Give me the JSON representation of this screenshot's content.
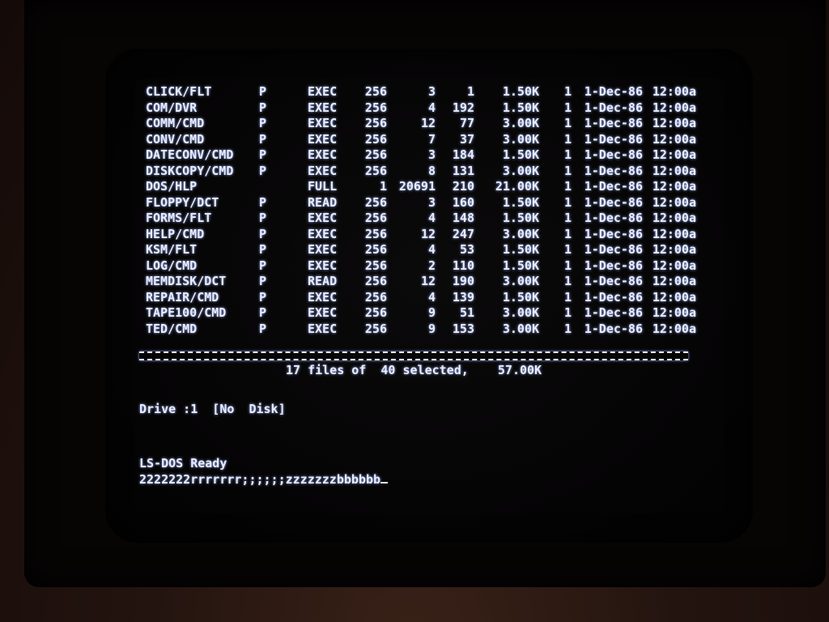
{
  "directory": {
    "rows": [
      {
        "name": "CLICK/FLT",
        "attr": "P",
        "access": "EXEC",
        "lrl": "256",
        "recs": "3",
        "eof": "1",
        "size": "1.50K",
        "ext": "1",
        "date": "1-Dec-86",
        "time": "12:00a"
      },
      {
        "name": "COM/DVR",
        "attr": "P",
        "access": "EXEC",
        "lrl": "256",
        "recs": "4",
        "eof": "192",
        "size": "1.50K",
        "ext": "1",
        "date": "1-Dec-86",
        "time": "12:00a"
      },
      {
        "name": "COMM/CMD",
        "attr": "P",
        "access": "EXEC",
        "lrl": "256",
        "recs": "12",
        "eof": "77",
        "size": "3.00K",
        "ext": "1",
        "date": "1-Dec-86",
        "time": "12:00a"
      },
      {
        "name": "CONV/CMD",
        "attr": "P",
        "access": "EXEC",
        "lrl": "256",
        "recs": "7",
        "eof": "37",
        "size": "3.00K",
        "ext": "1",
        "date": "1-Dec-86",
        "time": "12:00a"
      },
      {
        "name": "DATECONV/CMD",
        "attr": "P",
        "access": "EXEC",
        "lrl": "256",
        "recs": "3",
        "eof": "184",
        "size": "1.50K",
        "ext": "1",
        "date": "1-Dec-86",
        "time": "12:00a"
      },
      {
        "name": "DISKCOPY/CMD",
        "attr": "P",
        "access": "EXEC",
        "lrl": "256",
        "recs": "8",
        "eof": "131",
        "size": "3.00K",
        "ext": "1",
        "date": "1-Dec-86",
        "time": "12:00a"
      },
      {
        "name": "DOS/HLP",
        "attr": "",
        "access": "FULL",
        "lrl": "1",
        "recs": "20691",
        "eof": "210",
        "size": "21.00K",
        "ext": "1",
        "date": "1-Dec-86",
        "time": "12:00a"
      },
      {
        "name": "FLOPPY/DCT",
        "attr": "P",
        "access": "READ",
        "lrl": "256",
        "recs": "3",
        "eof": "160",
        "size": "1.50K",
        "ext": "1",
        "date": "1-Dec-86",
        "time": "12:00a"
      },
      {
        "name": "FORMS/FLT",
        "attr": "P",
        "access": "EXEC",
        "lrl": "256",
        "recs": "4",
        "eof": "148",
        "size": "1.50K",
        "ext": "1",
        "date": "1-Dec-86",
        "time": "12:00a"
      },
      {
        "name": "HELP/CMD",
        "attr": "P",
        "access": "EXEC",
        "lrl": "256",
        "recs": "12",
        "eof": "247",
        "size": "3.00K",
        "ext": "1",
        "date": "1-Dec-86",
        "time": "12:00a"
      },
      {
        "name": "KSM/FLT",
        "attr": "P",
        "access": "EXEC",
        "lrl": "256",
        "recs": "4",
        "eof": "53",
        "size": "1.50K",
        "ext": "1",
        "date": "1-Dec-86",
        "time": "12:00a"
      },
      {
        "name": "LOG/CMD",
        "attr": "P",
        "access": "EXEC",
        "lrl": "256",
        "recs": "2",
        "eof": "110",
        "size": "1.50K",
        "ext": "1",
        "date": "1-Dec-86",
        "time": "12:00a"
      },
      {
        "name": "MEMDISK/DCT",
        "attr": "P",
        "access": "READ",
        "lrl": "256",
        "recs": "12",
        "eof": "190",
        "size": "3.00K",
        "ext": "1",
        "date": "1-Dec-86",
        "time": "12:00a"
      },
      {
        "name": "REPAIR/CMD",
        "attr": "P",
        "access": "EXEC",
        "lrl": "256",
        "recs": "4",
        "eof": "139",
        "size": "1.50K",
        "ext": "1",
        "date": "1-Dec-86",
        "time": "12:00a"
      },
      {
        "name": "TAPE100/CMD",
        "attr": "P",
        "access": "EXEC",
        "lrl": "256",
        "recs": "9",
        "eof": "51",
        "size": "3.00K",
        "ext": "1",
        "date": "1-Dec-86",
        "time": "12:00a"
      },
      {
        "name": "TED/CMD",
        "attr": "P",
        "access": "EXEC",
        "lrl": "256",
        "recs": "9",
        "eof": "153",
        "size": "3.00K",
        "ext": "1",
        "date": "1-Dec-86",
        "time": "12:00a"
      }
    ],
    "summary": "17 files of  40 selected,    57.00K"
  },
  "drive_status": "Drive :1  [No  Disk]",
  "prompt": {
    "ready_text": "LS-DOS Ready",
    "command_input": "2222222rrrrrrr;;;;;;zzzzzzzbbbbbb"
  },
  "colors": {
    "phosphor": "#e8ecff",
    "glow": "#9fb6ff",
    "screen_background": "#050405"
  }
}
